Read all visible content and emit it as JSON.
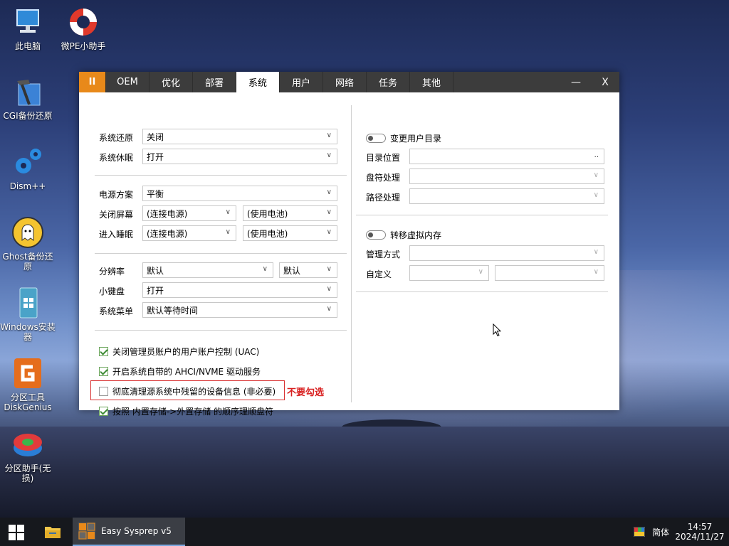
{
  "desktop": {
    "icons": [
      {
        "label": "此电脑",
        "icon": "computer-icon"
      },
      {
        "label": "微PE小助手",
        "icon": "lifebuoy-icon"
      },
      {
        "label": "CGI备份还原",
        "icon": "hammer-icon"
      },
      {
        "label": "Dism++",
        "icon": "gears-icon"
      },
      {
        "label": "Ghost备份还原",
        "icon": "ghost-icon"
      },
      {
        "label": "Windows安装器",
        "icon": "windows-setup-icon"
      },
      {
        "label": "分区工具DiskGenius",
        "icon": "diskgenius-icon"
      },
      {
        "label": "分区助手(无损)",
        "icon": "partition-assistant-icon"
      }
    ]
  },
  "window": {
    "logo": "II",
    "tabs": [
      "OEM",
      "优化",
      "部署",
      "系统",
      "用户",
      "网络",
      "任务",
      "其他"
    ],
    "active_tab": "系统",
    "minimize": "—",
    "close": "X",
    "left": {
      "system_restore": {
        "label": "系统还原",
        "value": "关闭"
      },
      "system_hibernate": {
        "label": "系统休眠",
        "value": "打开"
      },
      "power_plan": {
        "label": "电源方案",
        "value": "平衡"
      },
      "screen_off": {
        "label": "关闭屏幕",
        "value_ac": "(连接电源)",
        "value_dc": "(使用电池)"
      },
      "sleep": {
        "label": "进入睡眠",
        "value_ac": "(连接电源)",
        "value_dc": "(使用电池)"
      },
      "resolution": {
        "label": "分辨率",
        "value": "默认",
        "value2": "默认"
      },
      "keypad": {
        "label": "小键盘",
        "value": "打开"
      },
      "sys_menu": {
        "label": "系统菜单",
        "value": "默认等待时间"
      },
      "checks": [
        {
          "label": "关闭管理员账户的用户账户控制 (UAC)",
          "checked": true
        },
        {
          "label": "开启系统自带的 AHCI/NVME 驱动服务",
          "checked": true
        },
        {
          "label": "彻底清理源系统中残留的设备信息 (非必要)",
          "checked": false
        },
        {
          "label": "按照 内置存储->外置存储 的顺序理顺盘符",
          "checked": true
        }
      ],
      "note": "不要勾选"
    },
    "right": {
      "user_dir_toggle": "变更用户目录",
      "dir_location": {
        "label": "目录位置",
        "value": ".."
      },
      "drive_handling": {
        "label": "盘符处理",
        "value": ""
      },
      "path_handling": {
        "label": "路径处理",
        "value": ""
      },
      "vm_toggle": "转移虚拟内存",
      "manage_mode": {
        "label": "管理方式",
        "value": ""
      },
      "custom": {
        "label": "自定义",
        "value1": "",
        "value2": ""
      }
    }
  },
  "taskbar": {
    "app_title": "Easy Sysprep v5",
    "ime": "简体",
    "time": "14:57",
    "date": "2024/11/27"
  },
  "colors": {
    "accent_orange": "#e8891a",
    "titlebar": "#3c3c3c",
    "note_red": "#d82020",
    "check_green": "#3d8b34"
  }
}
